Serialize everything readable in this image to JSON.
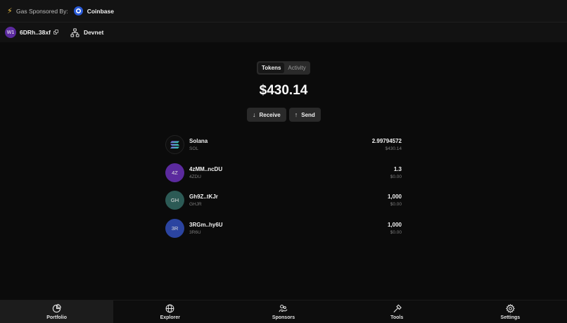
{
  "gas": {
    "label": "Gas Sponsored By:",
    "sponsor": "Coinbase"
  },
  "wallet": {
    "avatar": "W1",
    "address": "6DRh..38xf",
    "network": "Devnet"
  },
  "tabs": [
    {
      "label": "Tokens",
      "active": true
    },
    {
      "label": "Activity",
      "active": false
    }
  ],
  "balance": "$430.14",
  "actions": {
    "receive": "Receive",
    "send": "Send"
  },
  "tokens": [
    {
      "name": "Solana",
      "symbol": "SOL",
      "amount": "2.99794572",
      "usd": "$430.14",
      "avatar": "",
      "color": "#0e0e0e"
    },
    {
      "name": "4zMM..ncDU",
      "symbol": "4ZDU",
      "amount": "1.3",
      "usd": "$0.00",
      "avatar": "4Z",
      "color": "#5b2a9e"
    },
    {
      "name": "Gh9Z..tKJr",
      "symbol": "GHJR",
      "amount": "1,000",
      "usd": "$0.00",
      "avatar": "GH",
      "color": "#2c5a55"
    },
    {
      "name": "3RGm..hy6U",
      "symbol": "3R6U",
      "amount": "1,000",
      "usd": "$0.00",
      "avatar": "3R",
      "color": "#2b44a0"
    }
  ],
  "nav": [
    {
      "label": "Portfolio",
      "icon": "pie-chart-icon",
      "active": true
    },
    {
      "label": "Explorer",
      "icon": "globe-icon",
      "active": false
    },
    {
      "label": "Sponsors",
      "icon": "sponsors-icon",
      "active": false
    },
    {
      "label": "Tools",
      "icon": "hammer-icon",
      "active": false
    },
    {
      "label": "Settings",
      "icon": "gear-icon",
      "active": false
    }
  ],
  "colors": {
    "background": "#0b0b0b",
    "accent": "#2a5bd7"
  }
}
